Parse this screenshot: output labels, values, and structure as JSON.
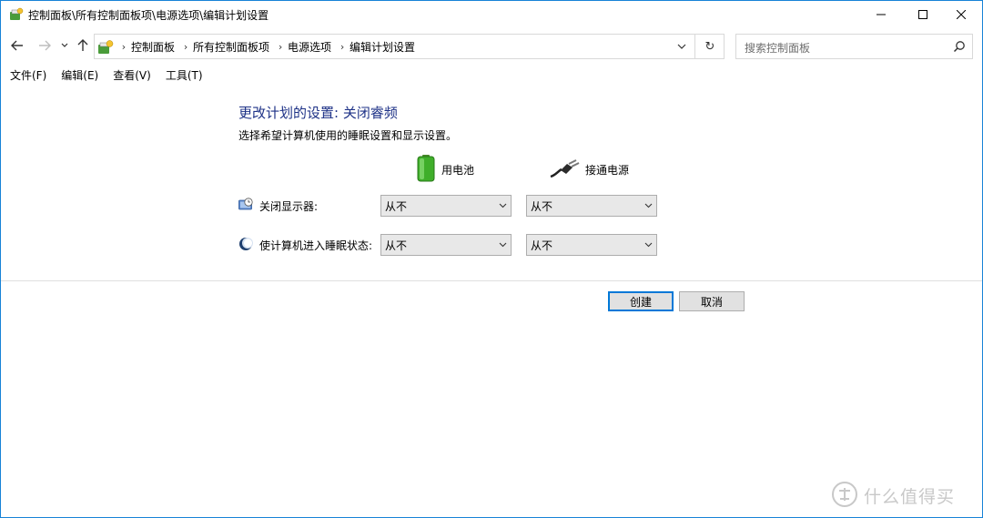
{
  "window": {
    "title": "控制面板\\所有控制面板项\\电源选项\\编辑计划设置"
  },
  "address": {
    "crumbs": [
      "控制面板",
      "所有控制面板项",
      "电源选项",
      "编辑计划设置"
    ],
    "refresh_glyph": "↻"
  },
  "search": {
    "placeholder": "搜索控制面板"
  },
  "menu": {
    "items": [
      "文件(F)",
      "编辑(E)",
      "查看(V)",
      "工具(T)"
    ]
  },
  "plan": {
    "title": "更改计划的设置: 关闭睿频",
    "description": "选择希望计算机使用的睡眠设置和显示设置。",
    "columns": {
      "battery": "用电池",
      "plugged": "接通电源"
    },
    "rows": {
      "display": {
        "label": "关闭显示器:",
        "battery": "从不",
        "plugged": "从不"
      },
      "sleep": {
        "label": "使计算机进入睡眠状态:",
        "battery": "从不",
        "plugged": "从不"
      }
    }
  },
  "actions": {
    "create": "创建",
    "cancel": "取消"
  },
  "watermark": {
    "text": "什么值得买"
  },
  "colors": {
    "accent": "#0078d7",
    "title_blue": "#1e3287",
    "window_border": "#1883d7"
  }
}
